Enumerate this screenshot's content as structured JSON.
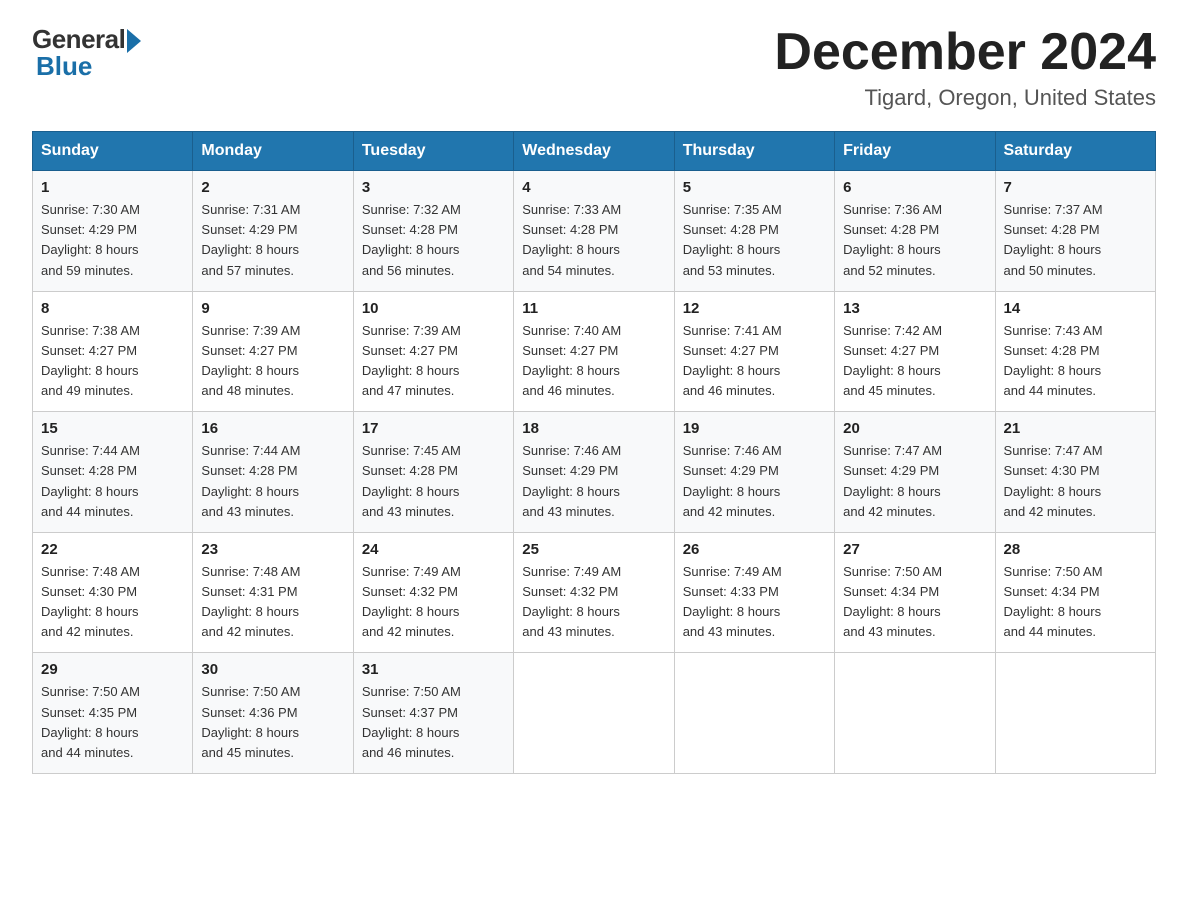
{
  "header": {
    "logo_general": "General",
    "logo_blue": "Blue",
    "month_year": "December 2024",
    "location": "Tigard, Oregon, United States"
  },
  "days_of_week": [
    "Sunday",
    "Monday",
    "Tuesday",
    "Wednesday",
    "Thursday",
    "Friday",
    "Saturday"
  ],
  "weeks": [
    [
      {
        "num": "1",
        "sunrise": "7:30 AM",
        "sunset": "4:29 PM",
        "daylight": "8 hours and 59 minutes."
      },
      {
        "num": "2",
        "sunrise": "7:31 AM",
        "sunset": "4:29 PM",
        "daylight": "8 hours and 57 minutes."
      },
      {
        "num": "3",
        "sunrise": "7:32 AM",
        "sunset": "4:28 PM",
        "daylight": "8 hours and 56 minutes."
      },
      {
        "num": "4",
        "sunrise": "7:33 AM",
        "sunset": "4:28 PM",
        "daylight": "8 hours and 54 minutes."
      },
      {
        "num": "5",
        "sunrise": "7:35 AM",
        "sunset": "4:28 PM",
        "daylight": "8 hours and 53 minutes."
      },
      {
        "num": "6",
        "sunrise": "7:36 AM",
        "sunset": "4:28 PM",
        "daylight": "8 hours and 52 minutes."
      },
      {
        "num": "7",
        "sunrise": "7:37 AM",
        "sunset": "4:28 PM",
        "daylight": "8 hours and 50 minutes."
      }
    ],
    [
      {
        "num": "8",
        "sunrise": "7:38 AM",
        "sunset": "4:27 PM",
        "daylight": "8 hours and 49 minutes."
      },
      {
        "num": "9",
        "sunrise": "7:39 AM",
        "sunset": "4:27 PM",
        "daylight": "8 hours and 48 minutes."
      },
      {
        "num": "10",
        "sunrise": "7:39 AM",
        "sunset": "4:27 PM",
        "daylight": "8 hours and 47 minutes."
      },
      {
        "num": "11",
        "sunrise": "7:40 AM",
        "sunset": "4:27 PM",
        "daylight": "8 hours and 46 minutes."
      },
      {
        "num": "12",
        "sunrise": "7:41 AM",
        "sunset": "4:27 PM",
        "daylight": "8 hours and 46 minutes."
      },
      {
        "num": "13",
        "sunrise": "7:42 AM",
        "sunset": "4:27 PM",
        "daylight": "8 hours and 45 minutes."
      },
      {
        "num": "14",
        "sunrise": "7:43 AM",
        "sunset": "4:28 PM",
        "daylight": "8 hours and 44 minutes."
      }
    ],
    [
      {
        "num": "15",
        "sunrise": "7:44 AM",
        "sunset": "4:28 PM",
        "daylight": "8 hours and 44 minutes."
      },
      {
        "num": "16",
        "sunrise": "7:44 AM",
        "sunset": "4:28 PM",
        "daylight": "8 hours and 43 minutes."
      },
      {
        "num": "17",
        "sunrise": "7:45 AM",
        "sunset": "4:28 PM",
        "daylight": "8 hours and 43 minutes."
      },
      {
        "num": "18",
        "sunrise": "7:46 AM",
        "sunset": "4:29 PM",
        "daylight": "8 hours and 43 minutes."
      },
      {
        "num": "19",
        "sunrise": "7:46 AM",
        "sunset": "4:29 PM",
        "daylight": "8 hours and 42 minutes."
      },
      {
        "num": "20",
        "sunrise": "7:47 AM",
        "sunset": "4:29 PM",
        "daylight": "8 hours and 42 minutes."
      },
      {
        "num": "21",
        "sunrise": "7:47 AM",
        "sunset": "4:30 PM",
        "daylight": "8 hours and 42 minutes."
      }
    ],
    [
      {
        "num": "22",
        "sunrise": "7:48 AM",
        "sunset": "4:30 PM",
        "daylight": "8 hours and 42 minutes."
      },
      {
        "num": "23",
        "sunrise": "7:48 AM",
        "sunset": "4:31 PM",
        "daylight": "8 hours and 42 minutes."
      },
      {
        "num": "24",
        "sunrise": "7:49 AM",
        "sunset": "4:32 PM",
        "daylight": "8 hours and 42 minutes."
      },
      {
        "num": "25",
        "sunrise": "7:49 AM",
        "sunset": "4:32 PM",
        "daylight": "8 hours and 43 minutes."
      },
      {
        "num": "26",
        "sunrise": "7:49 AM",
        "sunset": "4:33 PM",
        "daylight": "8 hours and 43 minutes."
      },
      {
        "num": "27",
        "sunrise": "7:50 AM",
        "sunset": "4:34 PM",
        "daylight": "8 hours and 43 minutes."
      },
      {
        "num": "28",
        "sunrise": "7:50 AM",
        "sunset": "4:34 PM",
        "daylight": "8 hours and 44 minutes."
      }
    ],
    [
      {
        "num": "29",
        "sunrise": "7:50 AM",
        "sunset": "4:35 PM",
        "daylight": "8 hours and 44 minutes."
      },
      {
        "num": "30",
        "sunrise": "7:50 AM",
        "sunset": "4:36 PM",
        "daylight": "8 hours and 45 minutes."
      },
      {
        "num": "31",
        "sunrise": "7:50 AM",
        "sunset": "4:37 PM",
        "daylight": "8 hours and 46 minutes."
      },
      null,
      null,
      null,
      null
    ]
  ],
  "labels": {
    "sunrise": "Sunrise:",
    "sunset": "Sunset:",
    "daylight": "Daylight:"
  }
}
